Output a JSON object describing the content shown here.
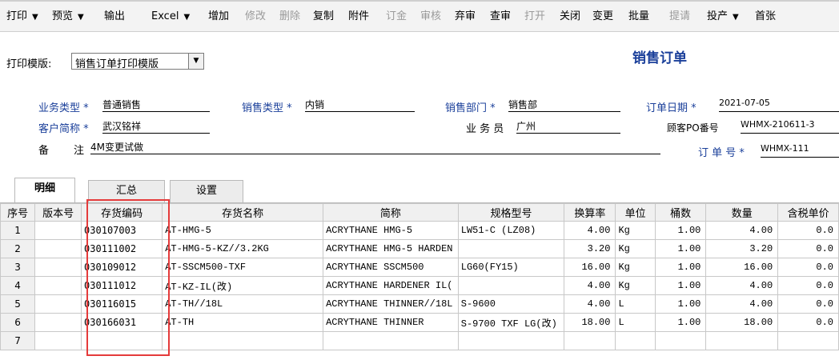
{
  "toolbar": [
    {
      "label": "打印",
      "dim": false,
      "arrow": true
    },
    {
      "label": "预览",
      "dim": false,
      "arrow": true
    },
    {
      "label": "输出",
      "dim": false,
      "arrow": false
    },
    {
      "label": "Excel",
      "dim": false,
      "arrow": true
    },
    {
      "label": "增加",
      "dim": false,
      "arrow": false
    },
    {
      "label": "修改",
      "dim": true,
      "arrow": false
    },
    {
      "label": "删除",
      "dim": true,
      "arrow": false
    },
    {
      "label": "复制",
      "dim": false,
      "arrow": false
    },
    {
      "label": "附件",
      "dim": false,
      "arrow": false
    },
    {
      "label": "订金",
      "dim": true,
      "arrow": false
    },
    {
      "label": "审核",
      "dim": true,
      "arrow": false
    },
    {
      "label": "弃审",
      "dim": false,
      "arrow": false
    },
    {
      "label": "查审",
      "dim": false,
      "arrow": false
    },
    {
      "label": "打开",
      "dim": true,
      "arrow": false
    },
    {
      "label": "关闭",
      "dim": false,
      "arrow": false
    },
    {
      "label": "变更",
      "dim": false,
      "arrow": false
    },
    {
      "label": "批量",
      "dim": false,
      "arrow": false
    },
    {
      "label": "提请",
      "dim": true,
      "arrow": false
    },
    {
      "label": "投产",
      "dim": false,
      "arrow": true
    },
    {
      "label": "首张",
      "dim": false,
      "arrow": false
    }
  ],
  "print_template": {
    "label": "打印模版:",
    "value": "销售订单打印模版"
  },
  "title": "销售订单",
  "fields": {
    "biz_type": {
      "label": "业务类型",
      "value": "普通销售"
    },
    "sale_type": {
      "label": "销售类型",
      "value": "内销"
    },
    "dept": {
      "label": "销售部门",
      "value": "销售部"
    },
    "order_date": {
      "label": "订单日期",
      "value": "2021-07-05"
    },
    "customer": {
      "label": "客户简称",
      "value": "武汉铭祥"
    },
    "salesman": {
      "label": "业 务 员",
      "value": "广州"
    },
    "po": {
      "label": "顾客PO番号",
      "value": "WHMX-210611-3"
    },
    "remark_label_1": "备",
    "remark_label_2": "注",
    "remark_value": "4M变更试做",
    "order_no": {
      "label": "订 单 号",
      "value": "WHMX-111"
    },
    "required_mark": "*"
  },
  "tabs": [
    "明细",
    "汇总",
    "设置"
  ],
  "grid": {
    "headers": [
      "序号",
      "版本号",
      "存货编码",
      "存货名称",
      "简称",
      "规格型号",
      "换算率",
      "单位",
      "桶数",
      "数量",
      "含税单价"
    ],
    "rows": [
      [
        "1",
        "",
        "030107003",
        "AT-HMG-5",
        "ACRYTHANE HMG-5",
        "LW51-C (LZ08)",
        "4.00",
        "Kg",
        "1.00",
        "4.00",
        "0.0"
      ],
      [
        "2",
        "",
        "030111002",
        "AT-HMG-5-KZ//3.2KG",
        "ACRYTHANE HMG-5 HARDEN",
        "",
        "3.20",
        "Kg",
        "1.00",
        "3.20",
        "0.0"
      ],
      [
        "3",
        "",
        "030109012",
        "AT-SSCM500-TXF",
        "ACRYTHANE SSCM500",
        "LG60(FY15)",
        "16.00",
        "Kg",
        "1.00",
        "16.00",
        "0.0"
      ],
      [
        "4",
        "",
        "030111012",
        "AT-KZ-IL(改)",
        "ACRYTHANE HARDENER IL(",
        "",
        "4.00",
        "Kg",
        "1.00",
        "4.00",
        "0.0"
      ],
      [
        "5",
        "",
        "030116015",
        "AT-TH//18L",
        "ACRYTHANE THINNER//18L",
        "S-9600",
        "4.00",
        "L",
        "1.00",
        "4.00",
        "0.0"
      ],
      [
        "6",
        "",
        "030166031",
        "AT-TH",
        "ACRYTHANE THINNER",
        "S-9700 TXF LG(改)",
        "18.00",
        "L",
        "1.00",
        "18.00",
        "0.0"
      ],
      [
        "7",
        "",
        "",
        "",
        "",
        "",
        "",
        "",
        "",
        "",
        ""
      ]
    ]
  },
  "colors": {
    "accent": "#1a3f9a",
    "highlight": "#e53b3b"
  }
}
